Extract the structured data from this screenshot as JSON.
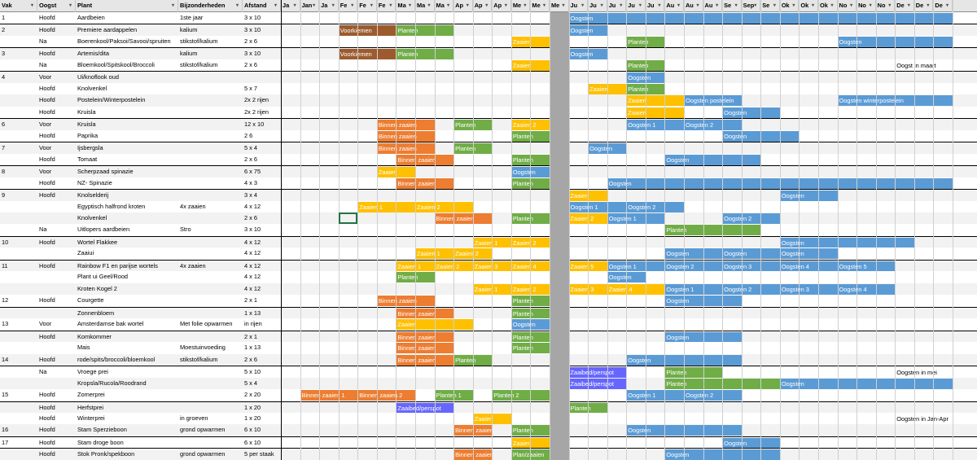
{
  "colors": {
    "brown": "#9c5b2e",
    "green": "#70ad47",
    "yellow": "#ffc000",
    "orange": "#ed7d31",
    "blue": "#5b9bd5",
    "purple": "#6666ff",
    "gray_col": "#a6a6a6",
    "header": "#e7e6e6"
  },
  "headers": {
    "vak": "Vak",
    "oogst": "Oogst",
    "plant": "Plant",
    "bijzonder": "Bijzonderheden",
    "afstand": "Afstand"
  },
  "month_headers": [
    "Ja",
    "Jan",
    "Ja",
    "Fe",
    "Fe",
    "Fe",
    "Ma",
    "Ma",
    "Ma",
    "Ap",
    "Ap",
    "Ap",
    "Me",
    "Me",
    "Me",
    "Ju",
    "Ju",
    "Ju",
    "Ju",
    "Ju",
    "Au",
    "Au",
    "Au",
    "Se",
    "Sep",
    "Se",
    "Ok",
    "Ok",
    "Ok",
    "No",
    "No",
    "No",
    "De",
    "De",
    "De"
  ],
  "rows": [
    {
      "vak": "1",
      "oogst": "Hoofd",
      "plant": "Aardbeien",
      "bijz": "1ste jaar",
      "afst": "3 x 10",
      "bars": [
        {
          "c": "blue",
          "s": 15,
          "e": 17,
          "t": "Oogsten"
        },
        {
          "c": "blue",
          "s": 17,
          "e": 35,
          "t": ""
        }
      ]
    },
    {
      "vak": "2",
      "oogst": "Hoofd",
      "plant": "Premiere aardappelen",
      "bijz": "kalium",
      "afst": "3 x 10",
      "bars": [
        {
          "c": "brown",
          "s": 3,
          "e": 6,
          "t": "Voorkiemen"
        },
        {
          "c": "green",
          "s": 6,
          "e": 9,
          "t": "Planten"
        },
        {
          "c": "blue",
          "s": 15,
          "e": 17,
          "t": "Oogsten"
        }
      ]
    },
    {
      "vak": "",
      "oogst": "Na",
      "plant": "Boerenkool/Paksoi/Savooi/spruiten",
      "bijz": "stikstof/kalium",
      "afst": "2 x 6",
      "bars": [
        {
          "c": "yellow",
          "s": 12,
          "e": 14,
          "t": "Zaaien"
        },
        {
          "c": "green",
          "s": 18,
          "e": 20,
          "t": "Planten"
        },
        {
          "c": "blue",
          "s": 29,
          "e": 35,
          "t": "Oogsten"
        }
      ]
    },
    {
      "vak": "3",
      "oogst": "Hoofd",
      "plant": "Artemis/dita",
      "bijz": "kalium",
      "afst": "3 x 10",
      "bars": [
        {
          "c": "brown",
          "s": 3,
          "e": 6,
          "t": "Voorkiemen"
        },
        {
          "c": "green",
          "s": 6,
          "e": 9,
          "t": "Planten"
        },
        {
          "c": "blue",
          "s": 15,
          "e": 17,
          "t": "Oogsten"
        }
      ]
    },
    {
      "vak": "",
      "oogst": "Na",
      "plant": "Bloemkool/Spitskool/Broccoli",
      "bijz": "stikstof/kalium",
      "afst": "2 x 6",
      "bars": [
        {
          "c": "yellow",
          "s": 12,
          "e": 14,
          "t": "Zaaien"
        },
        {
          "c": "green",
          "s": 18,
          "e": 20,
          "t": "Planten"
        }
      ],
      "note": {
        "s": 32,
        "t": "Oogst in maart"
      }
    },
    {
      "vak": "4",
      "oogst": "Voor",
      "plant": "Ui/knoflook oud",
      "bijz": "",
      "afst": "",
      "bars": [
        {
          "c": "blue",
          "s": 18,
          "e": 20,
          "t": "Oogsten"
        }
      ]
    },
    {
      "vak": "",
      "oogst": "Hoofd",
      "plant": "Knolvenkel",
      "bijz": "",
      "afst": "5 x 7",
      "bars": [
        {
          "c": "yellow",
          "s": 16,
          "e": 18,
          "t": "Zaaien"
        },
        {
          "c": "green",
          "s": 18,
          "e": 20,
          "t": "Planten"
        }
      ]
    },
    {
      "vak": "",
      "oogst": "Hoofd",
      "plant": "Postelein/Winterpostelein",
      "bijz": "",
      "afst": "2x 2 rijen",
      "bars": [
        {
          "c": "yellow",
          "s": 18,
          "e": 21,
          "t": "Zaaien"
        },
        {
          "c": "blue",
          "s": 21,
          "e": 24,
          "t": "Oogsten postelein"
        },
        {
          "c": "blue",
          "s": 29,
          "e": 35,
          "t": "Oogsten winterpostelein"
        }
      ]
    },
    {
      "vak": "",
      "oogst": "Hoofd",
      "plant": "Kruisla",
      "bijz": "",
      "afst": "2x 2 rijen",
      "bars": [
        {
          "c": "yellow",
          "s": 18,
          "e": 21,
          "t": "Zaaien"
        },
        {
          "c": "blue",
          "s": 23,
          "e": 26,
          "t": "Oogsten"
        }
      ]
    },
    {
      "vak": "6",
      "oogst": "Voor",
      "plant": "Kruisla",
      "bijz": "",
      "afst": "12 x 10",
      "bars": [
        {
          "c": "orange",
          "s": 5,
          "e": 8,
          "t": "Binnen zaaien"
        },
        {
          "c": "green",
          "s": 9,
          "e": 11,
          "t": "Planten"
        },
        {
          "c": "yellow",
          "s": 12,
          "e": 14,
          "t": "Zaaien 2"
        },
        {
          "c": "blue",
          "s": 18,
          "e": 21,
          "t": "Oogsten 1"
        },
        {
          "c": "blue",
          "s": 21,
          "e": 24,
          "t": "Oogsten 2"
        }
      ]
    },
    {
      "vak": "",
      "oogst": "Hoofd",
      "plant": "Paprika",
      "bijz": "",
      "afst": "2  6",
      "bars": [
        {
          "c": "orange",
          "s": 5,
          "e": 8,
          "t": "Binnen zaaien"
        },
        {
          "c": "green",
          "s": 12,
          "e": 14,
          "t": "Planten"
        },
        {
          "c": "blue",
          "s": 23,
          "e": 27,
          "t": "Oogsten"
        }
      ]
    },
    {
      "vak": "7",
      "oogst": "Voor",
      "plant": "Ijsbergsla",
      "bijz": "",
      "afst": "5 x 4",
      "bars": [
        {
          "c": "orange",
          "s": 5,
          "e": 8,
          "t": "Binnen zaaien"
        },
        {
          "c": "green",
          "s": 9,
          "e": 11,
          "t": "Planten"
        },
        {
          "c": "blue",
          "s": 16,
          "e": 18,
          "t": "Oogsten"
        }
      ]
    },
    {
      "vak": "",
      "oogst": "Hoofd",
      "plant": "Tomaat",
      "bijz": "",
      "afst": "2 x 6",
      "bars": [
        {
          "c": "orange",
          "s": 6,
          "e": 9,
          "t": "Binnen zaaien"
        },
        {
          "c": "green",
          "s": 12,
          "e": 14,
          "t": "Planten"
        },
        {
          "c": "blue",
          "s": 20,
          "e": 25,
          "t": "Oogsten"
        }
      ]
    },
    {
      "vak": "8",
      "oogst": "Voor",
      "plant": "Scherpzaad spinazie",
      "bijz": "",
      "afst": "6 x 75",
      "bars": [
        {
          "c": "yellow",
          "s": 5,
          "e": 7,
          "t": "Zaaien"
        },
        {
          "c": "blue",
          "s": 12,
          "e": 14,
          "t": "Oogsten"
        }
      ]
    },
    {
      "vak": "",
      "oogst": "Hoofd",
      "plant": "NZ- Spinazie",
      "bijz": "",
      "afst": "4 x 3",
      "bars": [
        {
          "c": "orange",
          "s": 6,
          "e": 9,
          "t": "Binnen zaaien"
        },
        {
          "c": "green",
          "s": 12,
          "e": 14,
          "t": "Planten"
        },
        {
          "c": "blue",
          "s": 17,
          "e": 35,
          "t": "Oogsten"
        }
      ]
    },
    {
      "vak": "9",
      "oogst": "Hoofd",
      "plant": "Knolselderij",
      "bijz": "",
      "afst": "3 x 4",
      "bars": [
        {
          "c": "yellow",
          "s": 15,
          "e": 17,
          "t": "Zaaien"
        },
        {
          "c": "blue",
          "s": 26,
          "e": 29,
          "t": "Oogsten"
        }
      ]
    },
    {
      "vak": "",
      "oogst": "",
      "plant": "Egyptisch halfrond kroten",
      "bijz": "4x zaaien",
      "afst": "4 x 12",
      "bars": [
        {
          "c": "yellow",
          "s": 4,
          "e": 7,
          "t": "Zaaien 1"
        },
        {
          "c": "yellow",
          "s": 7,
          "e": 10,
          "t": "Zaaien 2"
        },
        {
          "c": "blue",
          "s": 15,
          "e": 18,
          "t": "Oogsten 1"
        },
        {
          "c": "blue",
          "s": 18,
          "e": 21,
          "t": "Oogsten 2"
        }
      ]
    },
    {
      "vak": "",
      "oogst": "",
      "plant": "Knolvenkel",
      "bijz": "",
      "afst": "2 x 6",
      "bars": [
        {
          "c": "orange",
          "s": 8,
          "e": 11,
          "t": "Binnen zaaien"
        },
        {
          "c": "green",
          "s": 12,
          "e": 14,
          "t": "Planten"
        },
        {
          "c": "yellow",
          "s": 15,
          "e": 17,
          "t": "Zaaien 2"
        },
        {
          "c": "blue",
          "s": 17,
          "e": 20,
          "t": "Oogsten 1"
        },
        {
          "c": "blue",
          "s": 23,
          "e": 26,
          "t": "Oogsten 2"
        }
      ]
    },
    {
      "vak": "",
      "oogst": "Na",
      "plant": "Uitlopers aardbeien",
      "bijz": "Stro",
      "afst": "3 x 10",
      "bars": [
        {
          "c": "green",
          "s": 20,
          "e": 25,
          "t": "Planten"
        }
      ]
    },
    {
      "vak": "10",
      "oogst": "Hoofd",
      "plant": "Wortel Flakkee",
      "bijz": "",
      "afst": "4 x 12",
      "bars": [
        {
          "c": "yellow",
          "s": 10,
          "e": 12,
          "t": "Zaaien 1"
        },
        {
          "c": "yellow",
          "s": 12,
          "e": 14,
          "t": "Zaaien 2"
        },
        {
          "c": "blue",
          "s": 26,
          "e": 33,
          "t": "Oogsten"
        }
      ]
    },
    {
      "vak": "",
      "oogst": "",
      "plant": "Zaaiui",
      "bijz": "",
      "afst": "4 x 12",
      "bars": [
        {
          "c": "yellow",
          "s": 7,
          "e": 9,
          "t": "Zaaien 1"
        },
        {
          "c": "yellow",
          "s": 9,
          "e": 11,
          "t": "Zaaien 2"
        },
        {
          "c": "blue",
          "s": 20,
          "e": 23,
          "t": "Oogsten"
        },
        {
          "c": "blue",
          "s": 23,
          "e": 26,
          "t": "Oogsten"
        },
        {
          "c": "blue",
          "s": 26,
          "e": 29,
          "t": "Oogsten"
        }
      ]
    },
    {
      "vak": "11",
      "oogst": "Hoofd",
      "plant": "Rainbow F1 en parijse wortels",
      "bijz": "4x zaaien",
      "afst": "4 x 12",
      "bars": [
        {
          "c": "yellow",
          "s": 6,
          "e": 8,
          "t": "Zaaien 1"
        },
        {
          "c": "yellow",
          "s": 8,
          "e": 10,
          "t": "Zaaien 2"
        },
        {
          "c": "yellow",
          "s": 10,
          "e": 12,
          "t": "Zaaien 3"
        },
        {
          "c": "yellow",
          "s": 12,
          "e": 14,
          "t": "Zaaien 4"
        },
        {
          "c": "yellow",
          "s": 15,
          "e": 17,
          "t": "Zaaien 5"
        },
        {
          "c": "blue",
          "s": 17,
          "e": 20,
          "t": "Oogsten 1"
        },
        {
          "c": "blue",
          "s": 20,
          "e": 23,
          "t": "Oogsten 2"
        },
        {
          "c": "blue",
          "s": 23,
          "e": 26,
          "t": "Oogsten 3"
        },
        {
          "c": "blue",
          "s": 26,
          "e": 29,
          "t": "Oogsten 4"
        },
        {
          "c": "blue",
          "s": 29,
          "e": 32,
          "t": "Oogsten 5"
        }
      ]
    },
    {
      "vak": "",
      "oogst": "",
      "plant": "Plant ui Geel/Rood",
      "bijz": "",
      "afst": "4 x 12",
      "bars": [
        {
          "c": "green",
          "s": 6,
          "e": 8,
          "t": "Planten"
        },
        {
          "c": "blue",
          "s": 17,
          "e": 19,
          "t": "Oogsten"
        }
      ]
    },
    {
      "vak": "",
      "oogst": "",
      "plant": "Kroten Kogel 2",
      "bijz": "",
      "afst": "4 x 12",
      "bars": [
        {
          "c": "yellow",
          "s": 10,
          "e": 12,
          "t": "Zaaien 1"
        },
        {
          "c": "yellow",
          "s": 12,
          "e": 14,
          "t": "Zaaien 2"
        },
        {
          "c": "yellow",
          "s": 15,
          "e": 17,
          "t": "Zaaien 3"
        },
        {
          "c": "yellow",
          "s": 17,
          "e": 20,
          "t": "Zaaien 4"
        },
        {
          "c": "blue",
          "s": 20,
          "e": 23,
          "t": "Oogsten 1"
        },
        {
          "c": "blue",
          "s": 23,
          "e": 26,
          "t": "Oogsten 2"
        },
        {
          "c": "blue",
          "s": 26,
          "e": 29,
          "t": "Oogsten 3"
        },
        {
          "c": "blue",
          "s": 29,
          "e": 32,
          "t": "Oogsten 4"
        }
      ]
    },
    {
      "vak": "12",
      "oogst": "Hoofd",
      "plant": "Courgette",
      "bijz": "",
      "afst": "2 x 1",
      "bars": [
        {
          "c": "orange",
          "s": 5,
          "e": 8,
          "t": "Binnen zaaien"
        },
        {
          "c": "green",
          "s": 12,
          "e": 14,
          "t": "Planten"
        },
        {
          "c": "blue",
          "s": 20,
          "e": 24,
          "t": "Oogsten"
        }
      ]
    },
    {
      "vak": "",
      "oogst": "",
      "plant": "Zonnenbloem",
      "bijz": "",
      "afst": "1 x 13",
      "bars": [
        {
          "c": "orange",
          "s": 6,
          "e": 9,
          "t": "Binnen zaaien"
        },
        {
          "c": "green",
          "s": 12,
          "e": 14,
          "t": "Planten"
        }
      ]
    },
    {
      "vak": "13",
      "oogst": "Voor",
      "plant": "Amsterdamse bak wortel",
      "bijz": "Met folie opwarmen",
      "afst": "in rijen",
      "bars": [
        {
          "c": "yellow",
          "s": 6,
          "e": 10,
          "t": "Zaaien"
        },
        {
          "c": "blue",
          "s": 12,
          "e": 14,
          "t": "Oogsten"
        }
      ]
    },
    {
      "vak": "",
      "oogst": "Hoofd",
      "plant": "Komkommer",
      "bijz": "",
      "afst": "2 x 1",
      "bars": [
        {
          "c": "orange",
          "s": 6,
          "e": 9,
          "t": "Binnen zaaien"
        },
        {
          "c": "green",
          "s": 12,
          "e": 14,
          "t": "Planten"
        },
        {
          "c": "blue",
          "s": 20,
          "e": 24,
          "t": "Oogsten"
        }
      ]
    },
    {
      "vak": "",
      "oogst": "",
      "plant": "Mais",
      "bijz": "Moestuinvoeding",
      "afst": "1 x 13",
      "bars": [
        {
          "c": "orange",
          "s": 6,
          "e": 9,
          "t": "Binnen zaaien"
        },
        {
          "c": "green",
          "s": 12,
          "e": 14,
          "t": "Planten"
        }
      ]
    },
    {
      "vak": "14",
      "oogst": "Hoofd",
      "plant": "rode/spits/broccoli/bloemkool",
      "bijz": "stikstof/kalium",
      "afst": "2 x 6",
      "bars": [
        {
          "c": "orange",
          "s": 6,
          "e": 9,
          "t": "Binnen zaaien"
        },
        {
          "c": "green",
          "s": 9,
          "e": 11,
          "t": "Planten"
        },
        {
          "c": "blue",
          "s": 18,
          "e": 24,
          "t": "Oogsten"
        }
      ]
    },
    {
      "vak": "",
      "oogst": "Na",
      "plant": "Vroege prei",
      "bijz": "",
      "afst": "5 x 10",
      "bars": [
        {
          "c": "purple",
          "s": 15,
          "e": 18,
          "t": "Zaaibed/perspot"
        },
        {
          "c": "green",
          "s": 20,
          "e": 23,
          "t": "Planten"
        }
      ],
      "note": {
        "s": 32,
        "t": "Oogsten in mei"
      }
    },
    {
      "vak": "",
      "oogst": "",
      "plant": "Kropsla/Rucola/Roodrand",
      "bijz": "",
      "afst": "5 x 4",
      "bars": [
        {
          "c": "purple",
          "s": 15,
          "e": 18,
          "t": "Zaaibed/perspot"
        },
        {
          "c": "green",
          "s": 20,
          "e": 26,
          "t": "Planten"
        },
        {
          "c": "blue",
          "s": 26,
          "e": 35,
          "t": "Oogsten"
        }
      ]
    },
    {
      "vak": "15",
      "oogst": "Hoofd",
      "plant": "Zomerprei",
      "bijz": "",
      "afst": "2 x 20",
      "bars": [
        {
          "c": "orange",
          "s": 1,
          "e": 4,
          "t": "Binnen zaaien 1"
        },
        {
          "c": "orange",
          "s": 4,
          "e": 7,
          "t": "Binnen zaaien 2"
        },
        {
          "c": "green",
          "s": 8,
          "e": 10,
          "t": "Planten 1"
        },
        {
          "c": "green",
          "s": 11,
          "e": 14,
          "t": "Planten 2"
        },
        {
          "c": "blue",
          "s": 18,
          "e": 21,
          "t": "Oogsten 1"
        },
        {
          "c": "blue",
          "s": 21,
          "e": 24,
          "t": "Oogsten 2"
        }
      ]
    },
    {
      "vak": "",
      "oogst": "Hoofd",
      "plant": "Herfstprei",
      "bijz": "",
      "afst": "1 x 20",
      "bars": [
        {
          "c": "purple",
          "s": 6,
          "e": 9,
          "t": "Zaaibed/perspot"
        },
        {
          "c": "green",
          "s": 15,
          "e": 17,
          "t": "Planten"
        }
      ]
    },
    {
      "vak": "",
      "oogst": "Hoofd",
      "plant": "Winterprei",
      "bijz": "in groeven",
      "afst": "1 x 20",
      "bars": [
        {
          "c": "yellow",
          "s": 10,
          "e": 12,
          "t": "Zaaien"
        }
      ],
      "note": {
        "s": 32,
        "t": "Oogsten in Jan-Apr"
      }
    },
    {
      "vak": "16",
      "oogst": "Hoofd",
      "plant": "Stam Sperzieboon",
      "bijz": "grond opwarmen",
      "afst": "6 x 10",
      "bars": [
        {
          "c": "orange",
          "s": 9,
          "e": 11,
          "t": "Binnen zaaien"
        },
        {
          "c": "green",
          "s": 12,
          "e": 14,
          "t": "Planten"
        },
        {
          "c": "blue",
          "s": 18,
          "e": 24,
          "t": "Oogsten"
        }
      ]
    },
    {
      "vak": "17",
      "oogst": "Hoofd",
      "plant": "Stam droge boon",
      "bijz": "",
      "afst": "6 x 10",
      "bars": [
        {
          "c": "yellow",
          "s": 12,
          "e": 14,
          "t": "Zaaien"
        },
        {
          "c": "blue",
          "s": 23,
          "e": 26,
          "t": "Oogsten"
        }
      ]
    },
    {
      "vak": "",
      "oogst": "Hoofd",
      "plant": "Stok Pronk/spekboon",
      "bijz": "grond opwarmen",
      "afst": "5 per staak",
      "bars": [
        {
          "c": "orange",
          "s": 9,
          "e": 11,
          "t": "Binnen zaaien"
        },
        {
          "c": "green",
          "s": 12,
          "e": 14,
          "t": "Plan/zaaien"
        },
        {
          "c": "blue",
          "s": 20,
          "e": 23,
          "t": "Oogsten"
        },
        {
          "c": "blue",
          "s": 23,
          "e": 26,
          "t": ""
        }
      ]
    }
  ]
}
